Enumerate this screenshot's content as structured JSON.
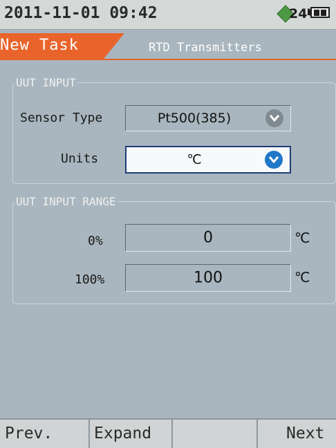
{
  "status": {
    "datetime": "2011-11-01 09:42",
    "voltage": "24V",
    "power_icon": "diamond-power-icon",
    "battery_icon": "battery-icon"
  },
  "tab": {
    "active_label": "New Task",
    "title": "RTD Transmitters"
  },
  "uut_input": {
    "legend": "UUT INPUT",
    "sensor_type_label": "Sensor Type",
    "sensor_type_value": "Pt500(385)",
    "units_label": "Units",
    "units_value": "℃"
  },
  "uut_input_range": {
    "legend": "UUT INPUT RANGE",
    "rows": [
      {
        "label": "0%",
        "value": "0",
        "unit": "℃"
      },
      {
        "label": "100%",
        "value": "100",
        "unit": "℃"
      }
    ]
  },
  "softkeys": {
    "prev": "Prev.",
    "expand": "Expand",
    "blank": "",
    "next": "Next"
  },
  "colors": {
    "accent": "#e9642b",
    "background": "#a9b6bf",
    "select_active": "#1f78c8"
  }
}
